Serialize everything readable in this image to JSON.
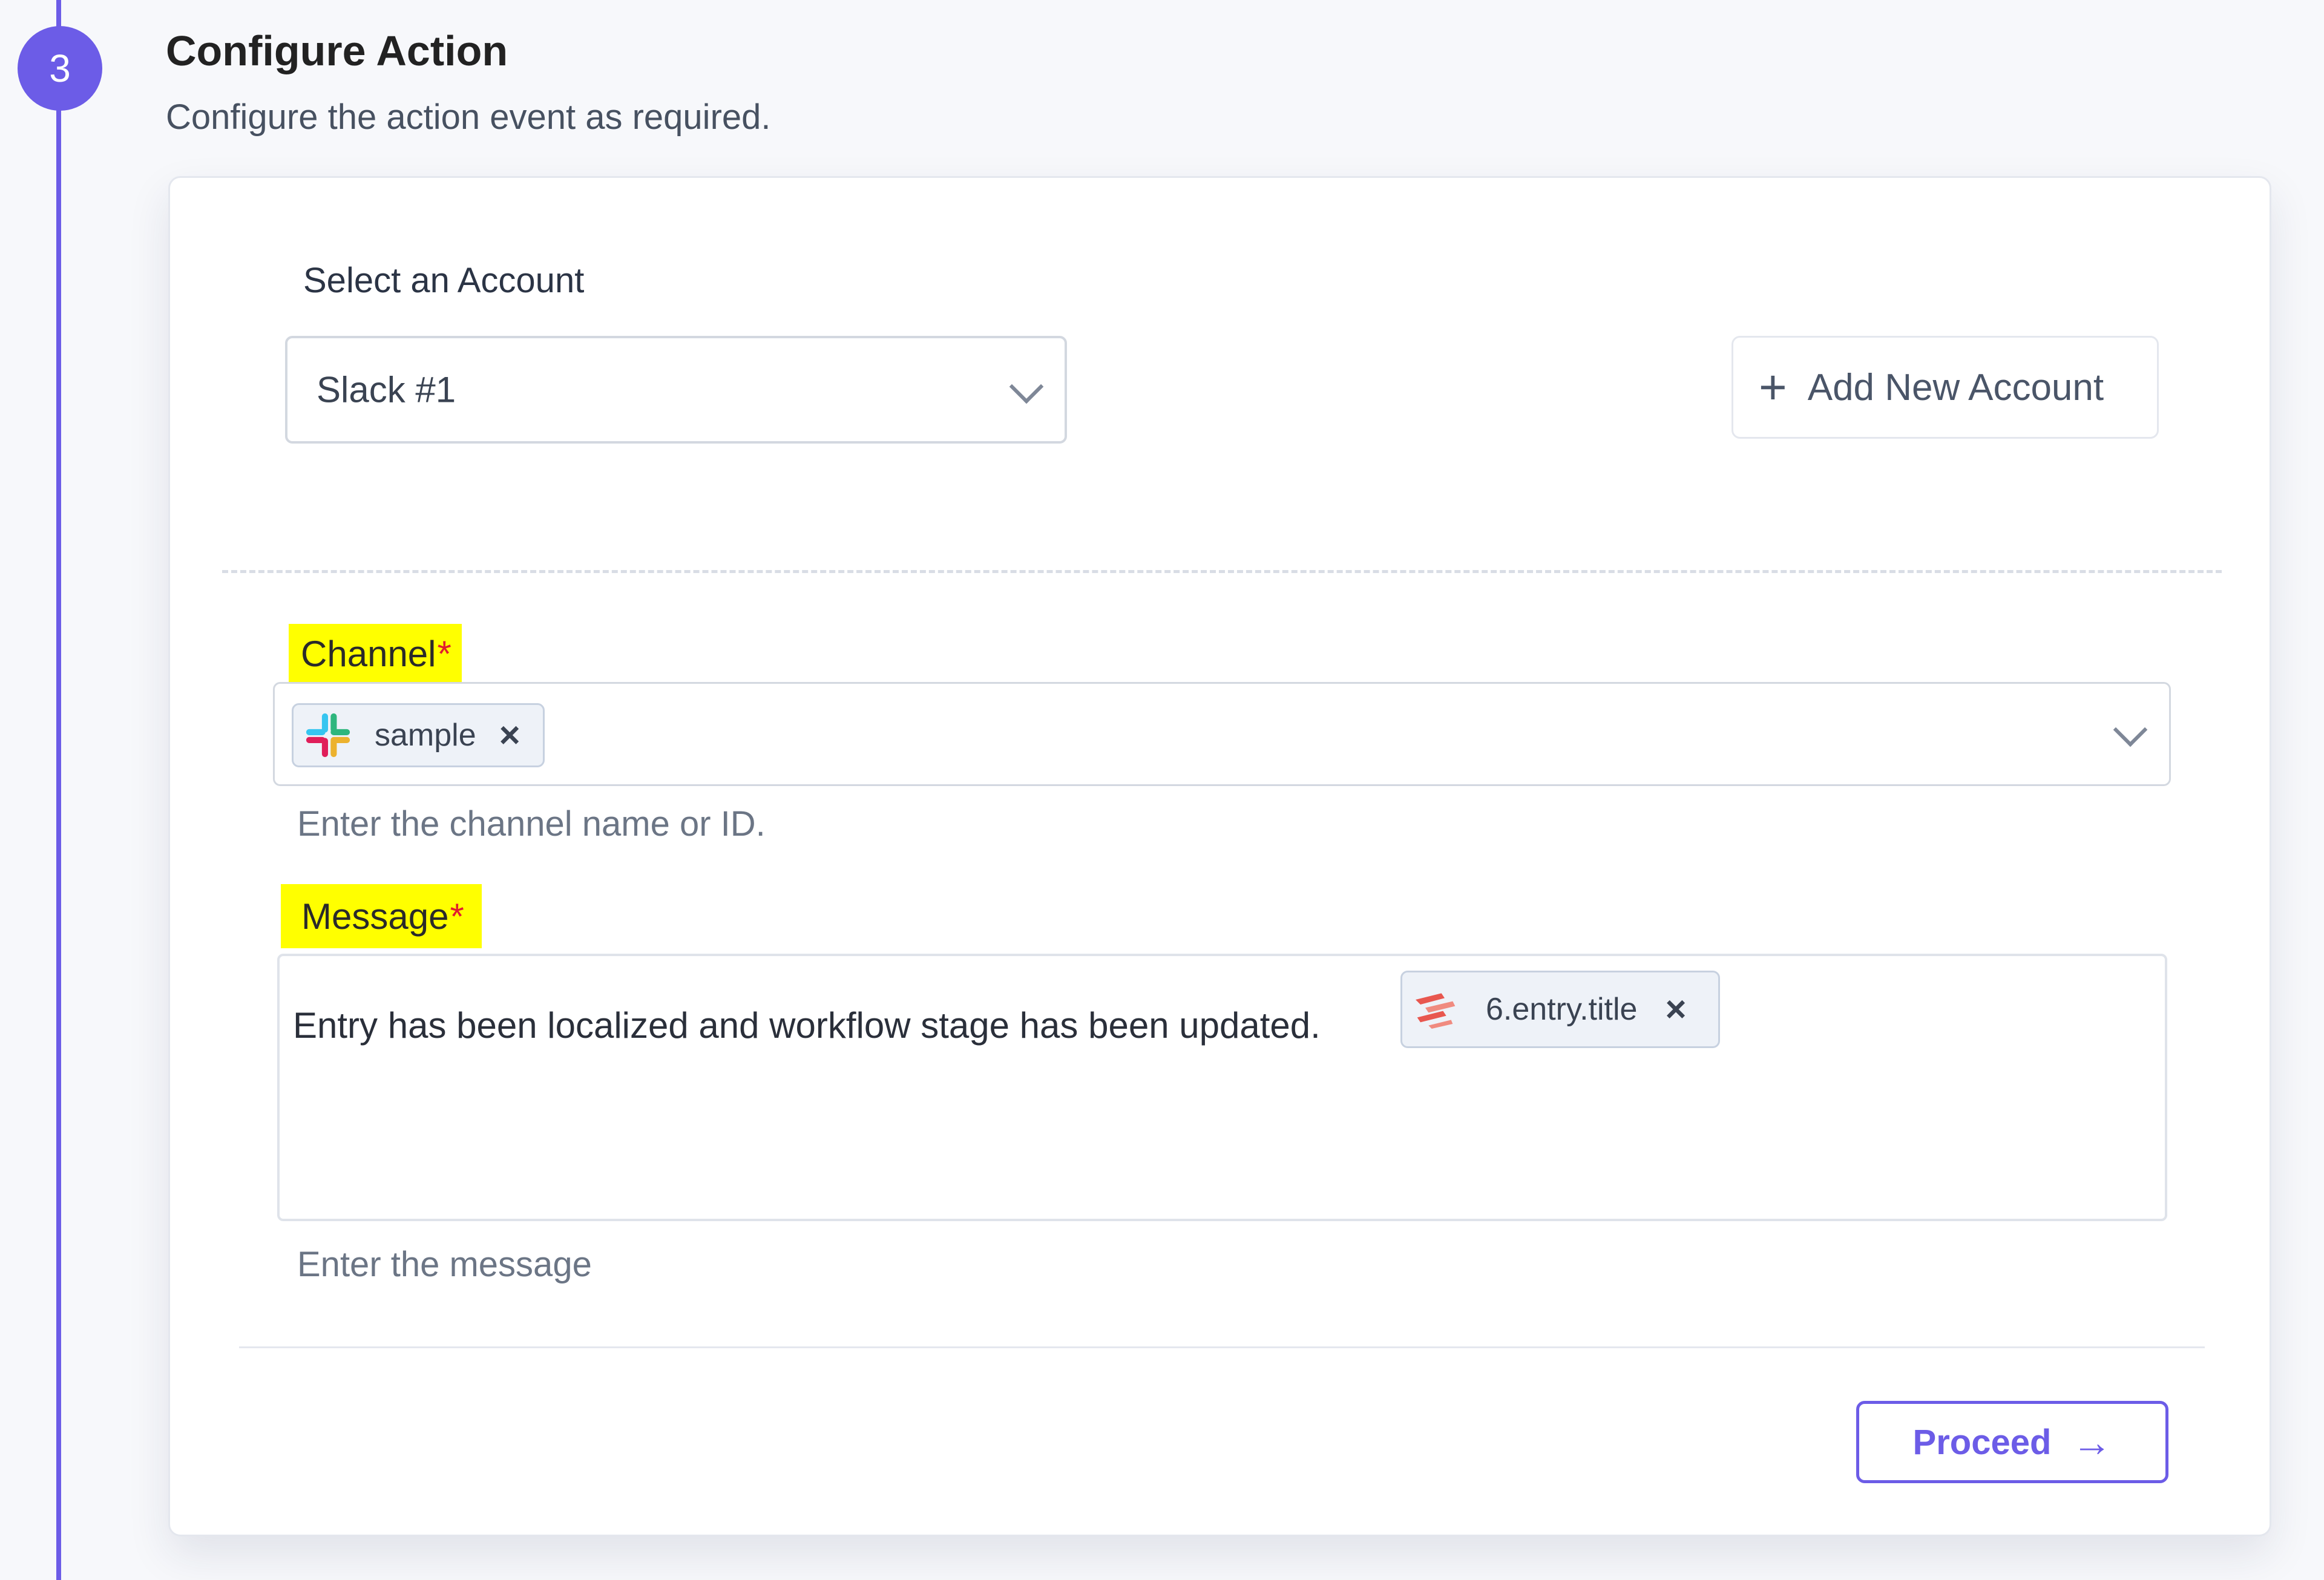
{
  "step": {
    "number": "3",
    "title": "Configure Action",
    "subtitle": "Configure the action event as required."
  },
  "account": {
    "label": "Select an Account",
    "selected": "Slack #1",
    "add_button_label": "Add New Account"
  },
  "channel": {
    "label": "Channel",
    "required_mark": "*",
    "tag_label": "sample",
    "hint": "Enter the channel name or ID."
  },
  "message": {
    "label": "Message",
    "required_mark": "*",
    "text": "Entry has been localized and workflow stage has been updated.",
    "tag_label": "6.entry.title",
    "hint": "Enter the message"
  },
  "footer": {
    "proceed_label": "Proceed"
  },
  "colors": {
    "accent": "#6c5ce7",
    "highlight": "#ffff00",
    "required": "#e11d2e"
  },
  "icons": {
    "close": "×",
    "plus": "+",
    "arrow": "→"
  }
}
